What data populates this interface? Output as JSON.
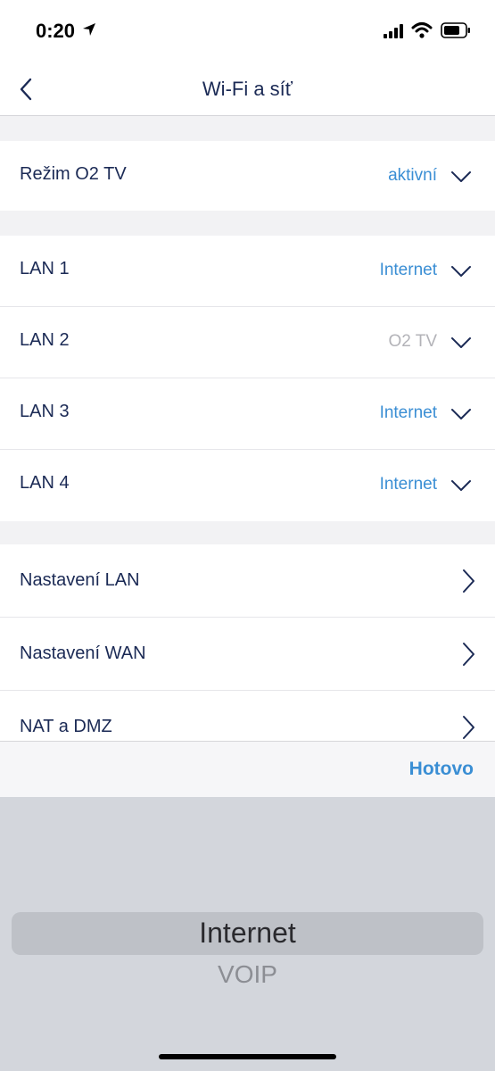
{
  "status_bar": {
    "time": "0:20"
  },
  "nav": {
    "title": "Wi-Fi a síť"
  },
  "tv_mode": {
    "label": "Režim O2 TV",
    "value": "aktivní"
  },
  "lan_ports": [
    {
      "label": "LAN 1",
      "value": "Internet"
    },
    {
      "label": "LAN 2",
      "value": "O2 TV"
    },
    {
      "label": "LAN 3",
      "value": "Internet"
    },
    {
      "label": "LAN 4",
      "value": "Internet"
    }
  ],
  "settings": [
    {
      "label": "Nastavení LAN"
    },
    {
      "label": "Nastavení WAN"
    },
    {
      "label": "NAT a DMZ"
    }
  ],
  "toolbar": {
    "done_label": "Hotovo"
  },
  "picker": {
    "selected": "Internet",
    "next": "VOIP"
  },
  "colors": {
    "accent": "#3a8ed4",
    "text": "#1b2a55",
    "muted": "#b3b3b8"
  }
}
